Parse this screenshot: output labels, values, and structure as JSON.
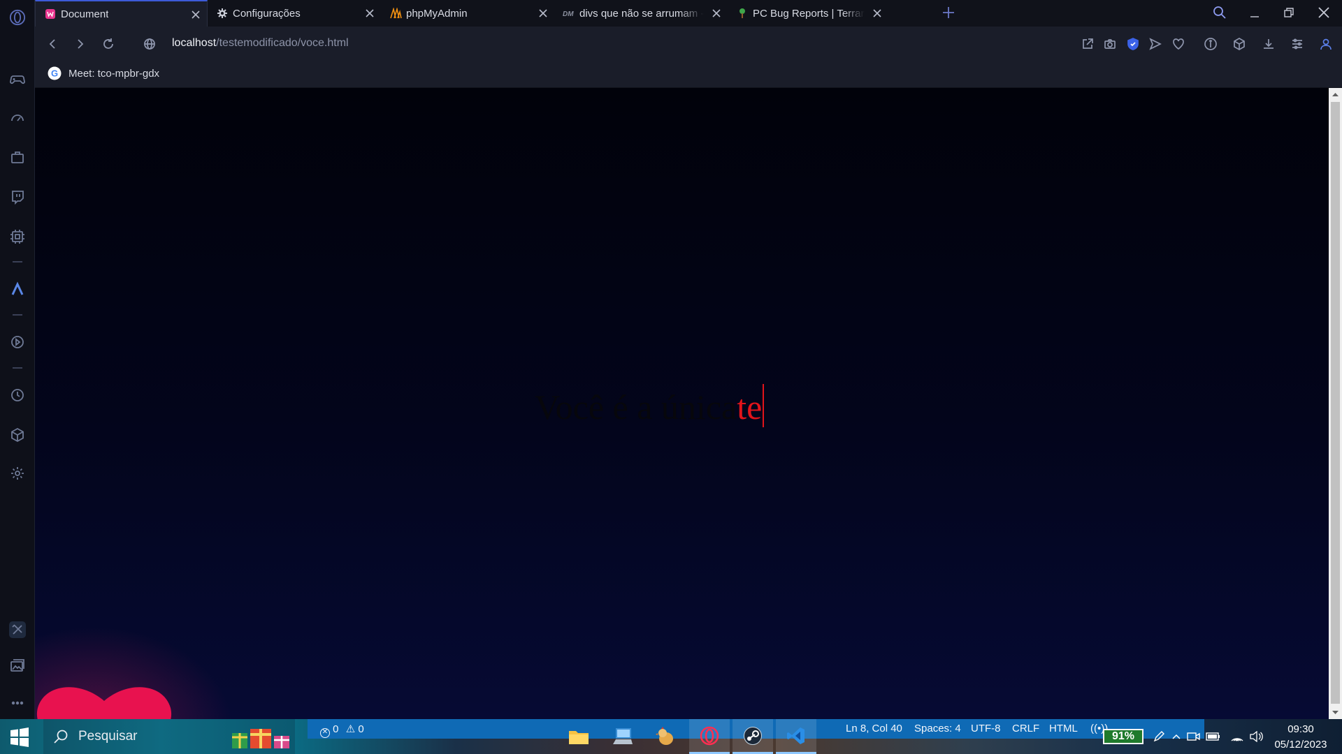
{
  "browser": {
    "tabs": [
      {
        "label": "Document",
        "active": true
      },
      {
        "label": "Configurações",
        "active": false
      },
      {
        "label": "phpMyAdmin",
        "active": false
      },
      {
        "label": "divs que não se arrumam -",
        "active": false
      },
      {
        "label": "PC Bug Reports | Terraria Co",
        "active": false
      }
    ],
    "url_host": "localhost",
    "url_path": "/testemodificado/voce.html",
    "bookmark": "Meet: tco-mpbr-gdx"
  },
  "sidebar": {
    "items": [
      "gamepad-icon",
      "speedometer-icon",
      "briefcase-icon",
      "twitch-icon",
      "cpu-icon",
      "aria-icon",
      "player-icon",
      "history-icon",
      "cube-icon",
      "settings-icon",
      "tools-icon",
      "gallery-icon",
      "more-icon"
    ]
  },
  "page": {
    "ghost_text": "Você é a única",
    "typed_text": "te",
    "ghost_color": "#07070c",
    "typed_color": "#e2141a"
  },
  "taskbar": {
    "search_placeholder": "Pesquisar",
    "problems_errors": "0",
    "problems_warnings": "0",
    "status_position": "Ln 8, Col 40",
    "status_spaces": "Spaces: 4",
    "status_encoding": "UTF-8",
    "status_eol": "CRLF",
    "status_language": "HTML",
    "battery": "91%",
    "time": "09:30",
    "date": "05/12/2023"
  },
  "colors": {
    "accent": "#3d5bd9",
    "vscode_status": "#0f6ab5"
  }
}
